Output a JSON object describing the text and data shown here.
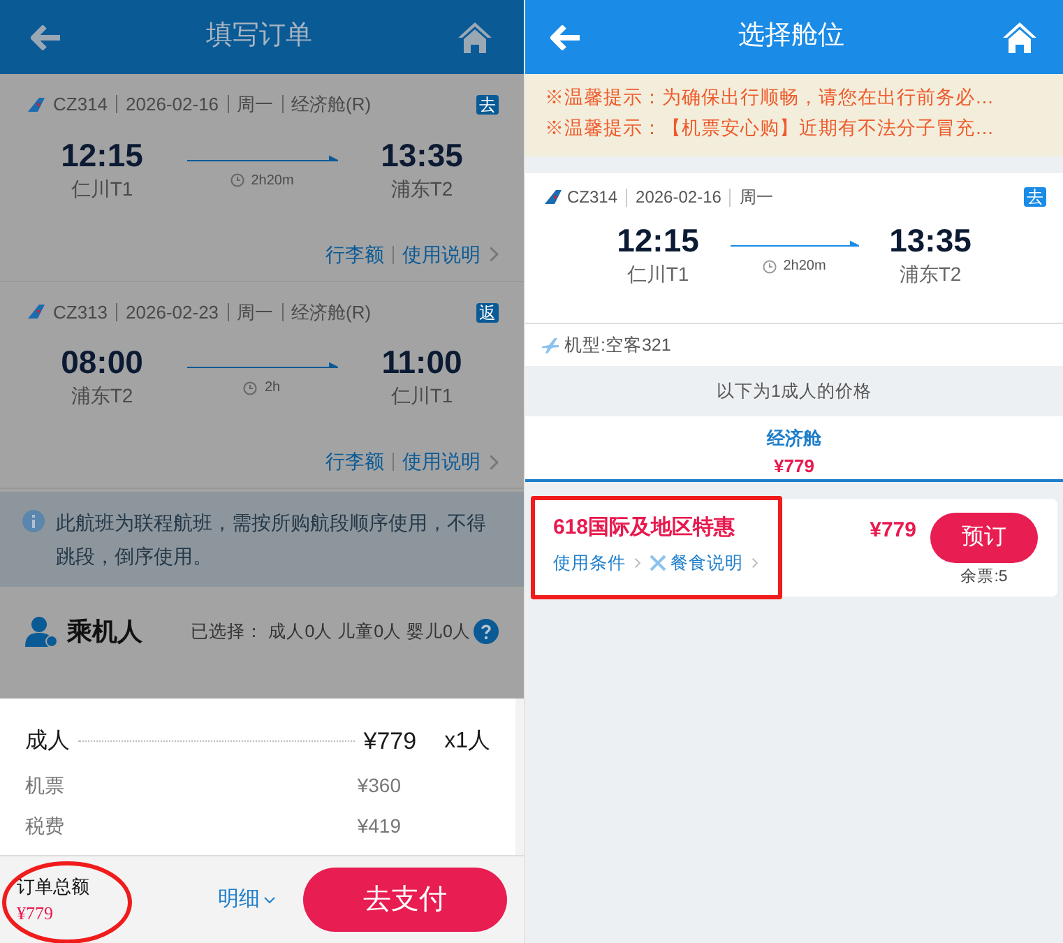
{
  "left_screen": {
    "title": "填写订单",
    "segments": [
      {
        "flight": "CZ314",
        "date": "2026-02-16",
        "weekday": "周一",
        "cabin": "经济舱(R)",
        "tag": "去",
        "depart_time": "12:15",
        "depart_airport": "仁川T1",
        "duration": "2h20m",
        "arrive_time": "13:35",
        "arrive_airport": "浦东T2",
        "links": [
          "行李额",
          "使用说明"
        ]
      },
      {
        "flight": "CZ313",
        "date": "2026-02-23",
        "weekday": "周一",
        "cabin": "经济舱(R)",
        "tag": "返",
        "depart_time": "08:00",
        "depart_airport": "浦东T2",
        "duration": "2h",
        "arrive_time": "11:00",
        "arrive_airport": "仁川T1",
        "links": [
          "行李额",
          "使用说明"
        ]
      }
    ],
    "notice": "此航班为联程航班，需按所购航段顺序使用，不得跳段，倒序使用。",
    "passengers": {
      "title": "乘机人",
      "selected": "已选择： 成人0人 儿童0人 婴儿0人"
    },
    "price_sheet": {
      "label": "成人",
      "price": "¥779",
      "count": "x1人",
      "items": [
        {
          "label": "机票",
          "price": "¥360"
        },
        {
          "label": "税费",
          "price": "¥419"
        }
      ]
    },
    "footer": {
      "total_label": "订单总额",
      "total": "¥779",
      "details": "明细",
      "pay": "去支付"
    }
  },
  "right_screen": {
    "title": "选择舱位",
    "tips": [
      "※温馨提示：为确保出行顺畅，请您在出行前务必…",
      "※温馨提示：【机票安心购】近期有不法分子冒充…"
    ],
    "flight": {
      "flight": "CZ314",
      "date": "2026-02-16",
      "weekday": "周一",
      "tag": "去",
      "depart_time": "12:15",
      "depart_airport": "仁川T1",
      "duration": "2h20m",
      "arrive_time": "13:35",
      "arrive_airport": "浦东T2"
    },
    "aircraft": "机型:空客321",
    "price_note": "以下为1成人的价格",
    "cabin_tabs": [
      {
        "label": "经济舱",
        "price": "¥779",
        "selected": true
      }
    ],
    "fares": [
      {
        "name": "618国际及地区特惠",
        "price": "¥779",
        "links": [
          "使用条件",
          "餐食说明"
        ],
        "book": "预订",
        "remaining": "余票:5"
      }
    ]
  }
}
